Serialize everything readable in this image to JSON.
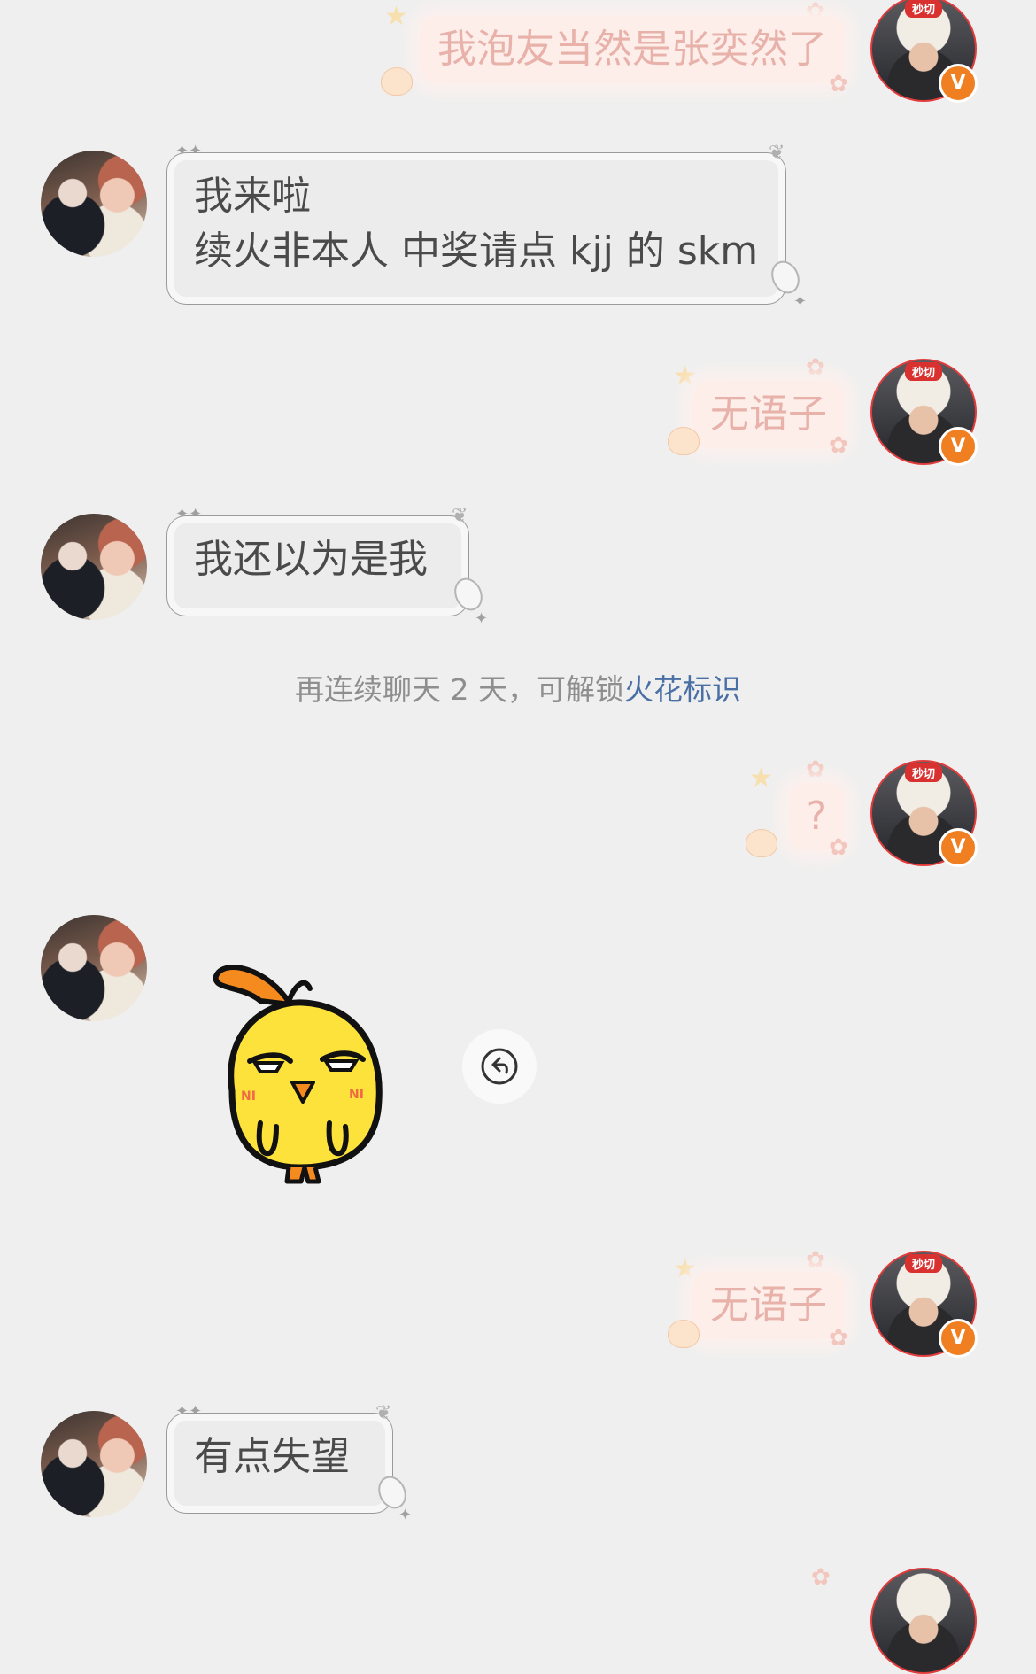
{
  "messages": [
    {
      "side": "right",
      "text": "我泡友当然是张奕然了"
    },
    {
      "side": "left",
      "lines": [
        "我来啦",
        "续火非本人 中奖请点 kjj 的 skm"
      ]
    },
    {
      "side": "right",
      "text": "无语子"
    },
    {
      "side": "left",
      "text": "我还以为是我"
    },
    {
      "side": "right",
      "text": "?"
    },
    {
      "side": "left",
      "type": "sticker",
      "sticker": "yellow-chick-sticker"
    },
    {
      "side": "right",
      "text": "无语子"
    },
    {
      "side": "left",
      "text": "有点失望"
    }
  ],
  "system_hint": {
    "prefix": "再连续聊天 2 天，可解锁",
    "link": "火花标识"
  },
  "avatar": {
    "right_tag": "秒切",
    "badge_letter": "V"
  },
  "colors": {
    "background": "#efefef",
    "left_bubble": "#ececec",
    "right_bubble": "#fdeeea",
    "right_text": "#e8b2ab",
    "link": "#4a6fa5",
    "badge": "#f07f21"
  },
  "icons": {
    "quote_button": "reply-arrow-icon"
  }
}
